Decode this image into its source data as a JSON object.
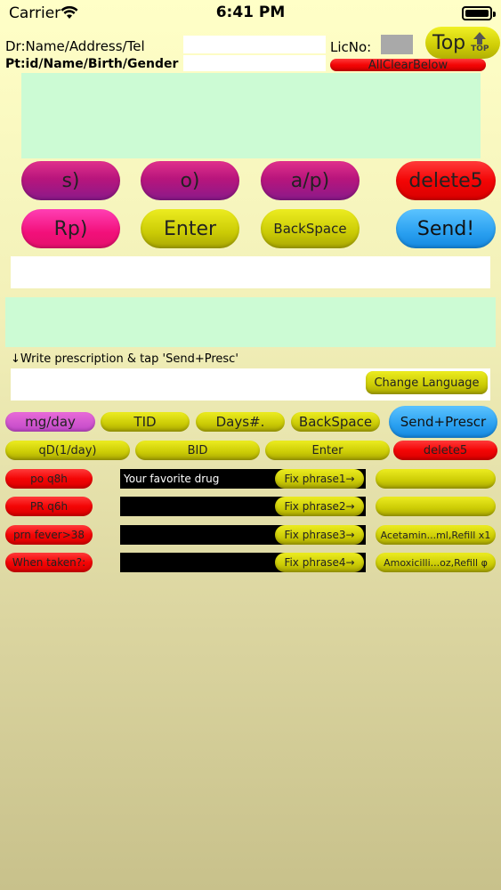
{
  "status": {
    "carrier": "Carrier",
    "time": "6:41 PM"
  },
  "header": {
    "dr_label": "Dr:Name/Address/Tel",
    "pt_label": "Pt:id/Name/Birth/Gender",
    "lic_label": "LicNo:",
    "top_label": "Top",
    "top_icon_text": "TOP",
    "all_clear": "AllClearBelow"
  },
  "soap": {
    "s": "s)",
    "o": "o)",
    "ap": "a/p)",
    "delete5": "delete5",
    "rp": "Rp)",
    "enter": "Enter",
    "backspace": "BackSpace",
    "send": "Send!"
  },
  "prescription": {
    "instruction": "↓Write prescription & tap 'Send+Presc'",
    "change_language": "Change Language"
  },
  "dose_row1": {
    "mgday": "mg/day",
    "tid": "TID",
    "days": "Days#.",
    "backspace": "BackSpace",
    "send_prescr": "Send+Prescr"
  },
  "dose_row2": {
    "qd": "qD(1/day)",
    "bid": "BID",
    "enter": "Enter",
    "delete5": "delete5"
  },
  "phrases": [
    {
      "red": "po q8h",
      "field": "Your favorite drug",
      "fix": "Fix phrase1→",
      "right": ""
    },
    {
      "red": "PR q6h",
      "field": "",
      "fix": "Fix phrase2→",
      "right": ""
    },
    {
      "red": "prn fever>38",
      "field": "",
      "fix": "Fix phrase3→",
      "right": "Acetamin...ml,Refill x1"
    },
    {
      "red": "When taken?:",
      "field": "",
      "fix": "Fix phrase4→",
      "right": "Amoxicilli...oz,Refill φ"
    }
  ]
}
